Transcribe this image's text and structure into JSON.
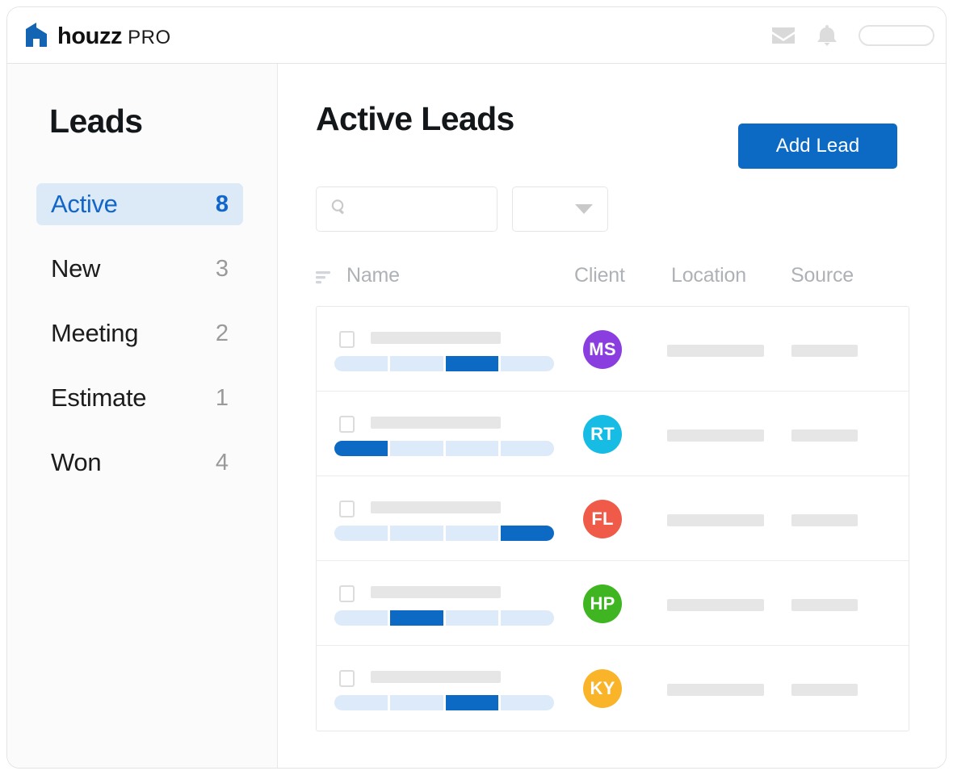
{
  "app": {
    "brand_name": "houzz",
    "brand_suffix": "PRO",
    "logo_color": "#1464b4"
  },
  "topbar": {
    "icons": [
      {
        "name": "mail-icon",
        "label": "Messages"
      },
      {
        "name": "bell-icon",
        "label": "Notifications"
      }
    ],
    "pill_placeholder_label": ""
  },
  "sidebar": {
    "title": "Leads",
    "items": [
      {
        "label": "Active",
        "count": "8",
        "active": true
      },
      {
        "label": "New",
        "count": "3",
        "active": false
      },
      {
        "label": "Meeting",
        "count": "2",
        "active": false
      },
      {
        "label": "Estimate",
        "count": "1",
        "active": false
      },
      {
        "label": "Won",
        "count": "4",
        "active": false
      }
    ],
    "active_bg": "#dce9f7",
    "active_fg": "#1266c9"
  },
  "main": {
    "title": "Active Leads",
    "add_lead_label": "Add Lead",
    "accent_color": "#0d6ac4",
    "search": {
      "value": "",
      "placeholder": "",
      "icon": "search-icon"
    },
    "filter_select": {
      "value": "",
      "icon": "chevron-down-icon"
    },
    "table": {
      "sort_icon": "sort-icon",
      "columns": [
        "Name",
        "Client",
        "Location",
        "Source"
      ],
      "rows": [
        {
          "name": "",
          "steps": 4,
          "current_step": 3,
          "avatar": {
            "initials": "MS",
            "color": "#8b3ee0"
          },
          "location": "",
          "source": ""
        },
        {
          "name": "",
          "steps": 4,
          "current_step": 1,
          "avatar": {
            "initials": "RT",
            "color": "#16bce4"
          },
          "location": "",
          "source": ""
        },
        {
          "name": "",
          "steps": 4,
          "current_step": 4,
          "avatar": {
            "initials": "FL",
            "color": "#f05a48"
          },
          "location": "",
          "source": ""
        },
        {
          "name": "",
          "steps": 4,
          "current_step": 2,
          "avatar": {
            "initials": "HP",
            "color": "#3eb521"
          },
          "location": "",
          "source": ""
        },
        {
          "name": "",
          "steps": 4,
          "current_step": 3,
          "avatar": {
            "initials": "KY",
            "color": "#f9b захва"
          },
          "location": "",
          "source": ""
        }
      ]
    }
  }
}
